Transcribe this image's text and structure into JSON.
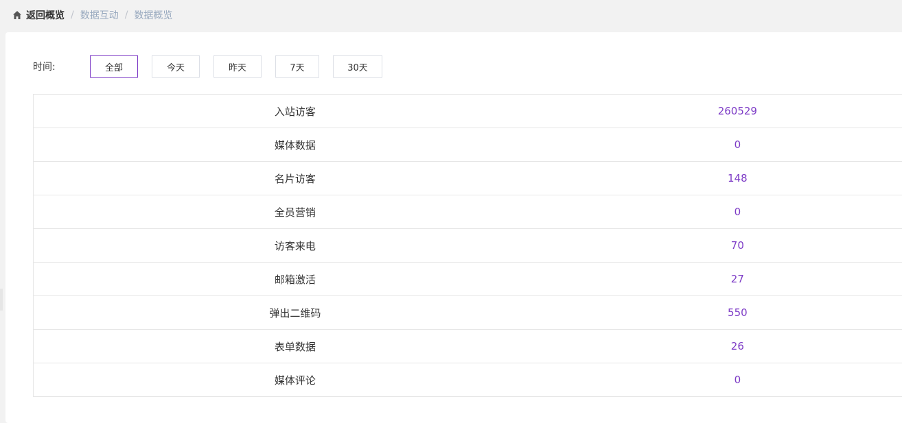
{
  "breadcrumb": {
    "home": "返回概览",
    "items": [
      "数据互动",
      "数据概览"
    ],
    "separator": "/"
  },
  "filter": {
    "label": "时间:",
    "options": [
      "全部",
      "今天",
      "昨天",
      "7天",
      "30天"
    ],
    "selected": "全部"
  },
  "stats": [
    {
      "name": "入站访客",
      "value": "260529"
    },
    {
      "name": "媒体数据",
      "value": "0"
    },
    {
      "name": "名片访客",
      "value": "148"
    },
    {
      "name": "全员营销",
      "value": "0"
    },
    {
      "name": "访客来电",
      "value": "70"
    },
    {
      "name": "邮箱激活",
      "value": "27"
    },
    {
      "name": "弹出二维码",
      "value": "550"
    },
    {
      "name": "表单数据",
      "value": "26"
    },
    {
      "name": "媒体评论",
      "value": "0"
    }
  ],
  "colors": {
    "accent": "#7d3bc6",
    "border": "#e6e6e6",
    "breadcrumb_muted": "#97a8be"
  }
}
